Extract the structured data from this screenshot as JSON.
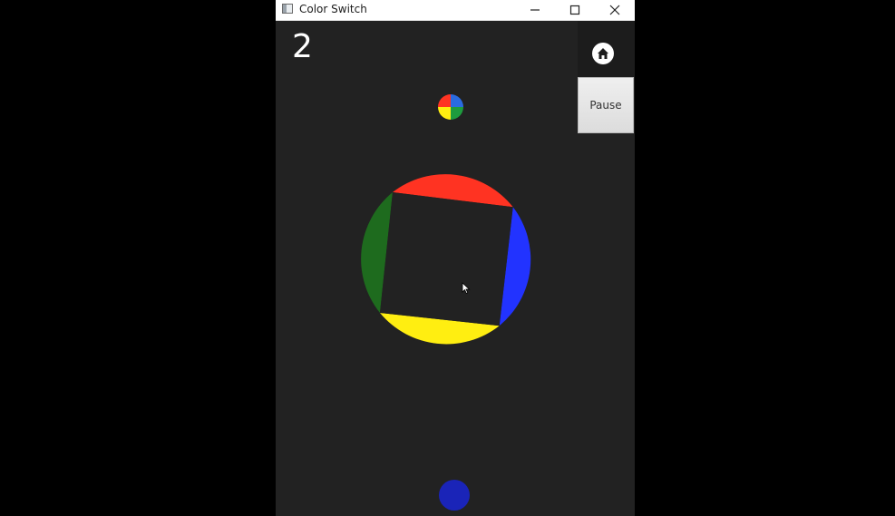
{
  "window": {
    "title": "Color Switch",
    "controls": {
      "minimize_glyph": "—",
      "maximize_glyph": "☐",
      "close_glyph": "✕"
    }
  },
  "game": {
    "score": "2",
    "pause_label": "Pause",
    "home_icon": "home-icon",
    "ball_color": "#1a24b8",
    "ring_colors": {
      "top": "#ff3322",
      "right": "#2233ff",
      "bottom": "#ffee11",
      "left": "#1e6b1e"
    },
    "switcher_colors": [
      "#ff3322",
      "#2233ff",
      "#ffee11",
      "#1e9b3e"
    ]
  },
  "colors": {
    "background": "#222222",
    "outer": "#000000"
  }
}
